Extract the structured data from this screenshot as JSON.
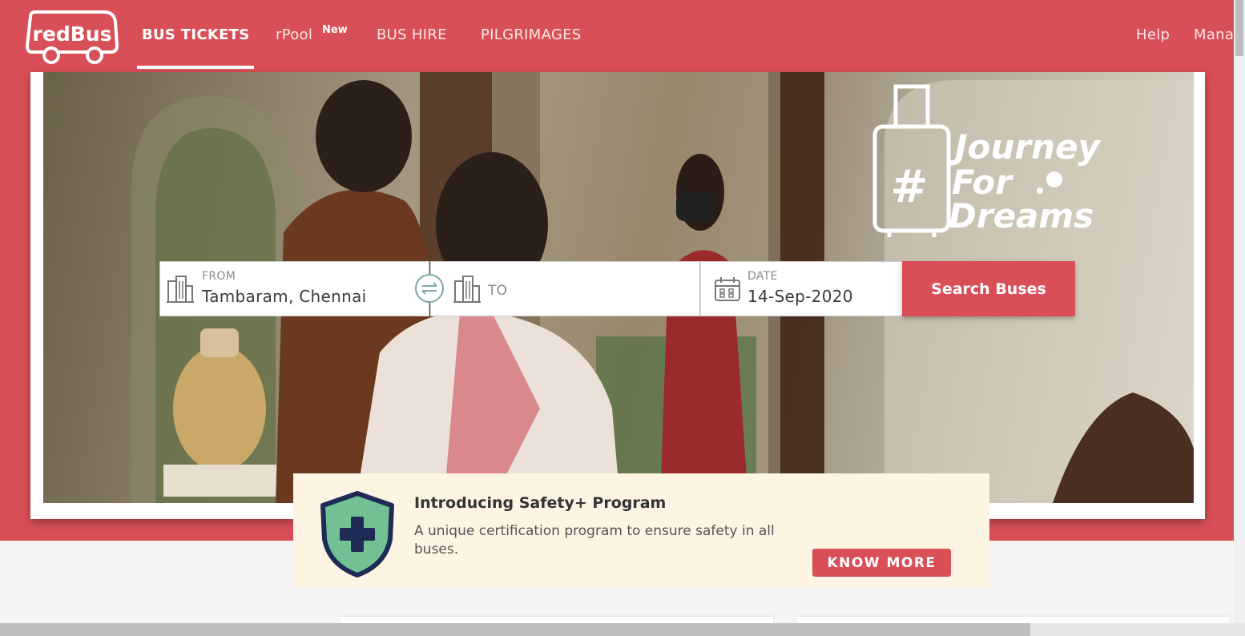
{
  "brand": {
    "logo_text": "redBus",
    "color": "#d84f57"
  },
  "nav": {
    "items": [
      {
        "label": "BUS TICKETS",
        "active": true
      },
      {
        "label": "rPool",
        "badge": "New"
      },
      {
        "label": "BUS HIRE"
      },
      {
        "label": "PILGRIMAGES"
      }
    ],
    "right": [
      {
        "label": "Help"
      },
      {
        "label": "Mana"
      }
    ]
  },
  "hero": {
    "campaign_line1": "Journey",
    "campaign_line2": "For",
    "campaign_line3": "Dreams",
    "campaign_hash": "#"
  },
  "search": {
    "from": {
      "label": "FROM",
      "value": "Tambaram, Chennai",
      "icon": "city-icon"
    },
    "swap_icon": "swap-icon",
    "to": {
      "label": "TO",
      "value": "",
      "icon": "city-icon"
    },
    "date": {
      "label": "DATE",
      "value": "14-Sep-2020",
      "icon": "calendar-icon"
    },
    "button_label": "Search Buses"
  },
  "safety": {
    "title": "Introducing Safety+ Program",
    "description": "A unique certification program to ensure safety in all buses.",
    "button_label": "KNOW MORE",
    "icon": "shield-plus-icon"
  }
}
